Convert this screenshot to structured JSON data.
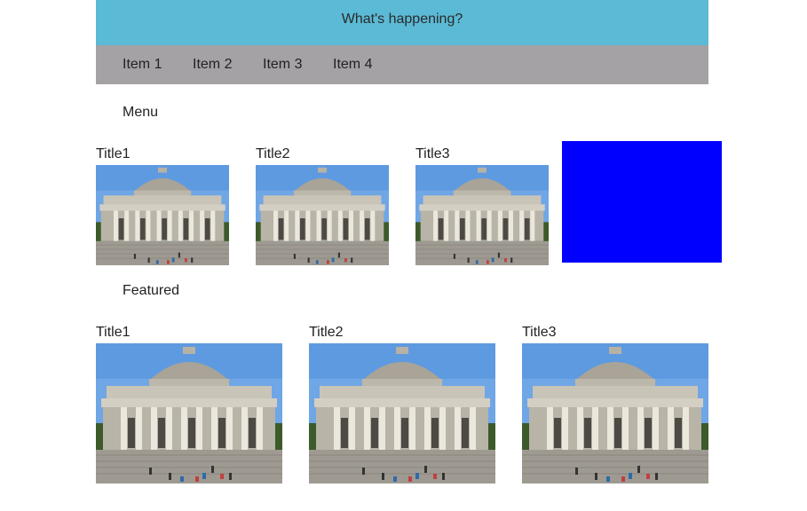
{
  "header": {
    "title": "What's happening?"
  },
  "nav": {
    "items": [
      "Item 1",
      "Item 2",
      "Item 3",
      "Item 4"
    ]
  },
  "menu": {
    "label": "Menu",
    "cards": [
      {
        "title": "Title1"
      },
      {
        "title": "Title2"
      },
      {
        "title": "Title3"
      }
    ]
  },
  "featured": {
    "label": "Featured",
    "cards": [
      {
        "title": "Title1"
      },
      {
        "title": "Title2"
      },
      {
        "title": "Title3"
      }
    ]
  },
  "colors": {
    "header_bg": "#5bbad5",
    "nav_bg": "#a5a2a5",
    "accent_box": "#0000ff"
  }
}
